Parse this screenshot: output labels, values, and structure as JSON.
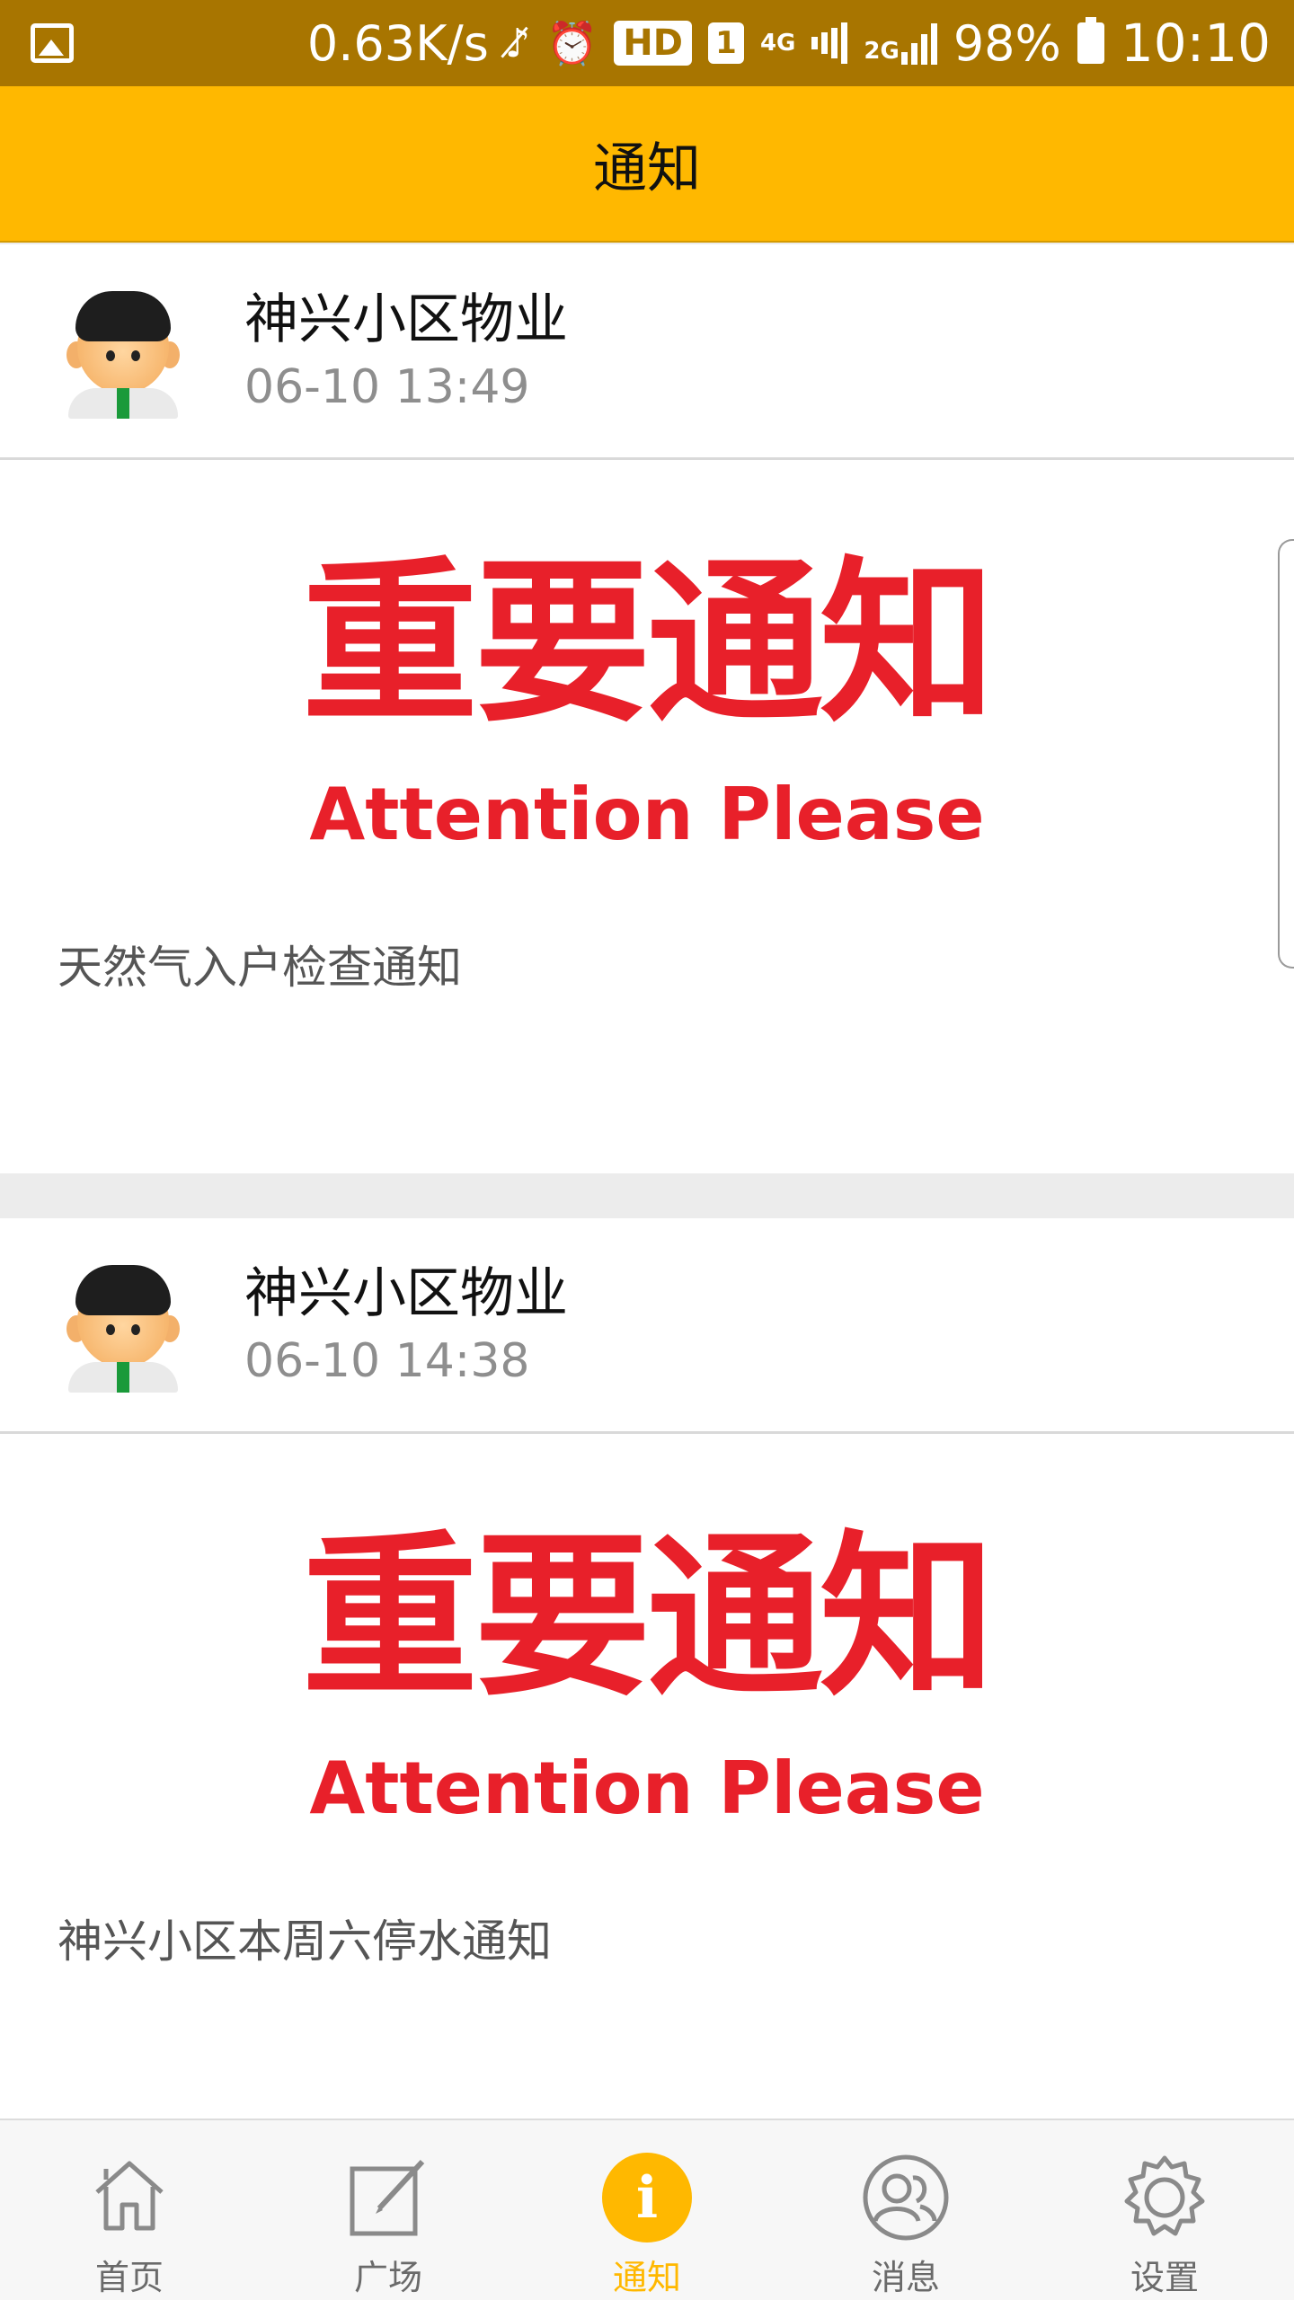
{
  "status_bar": {
    "speed": "0.63K/s",
    "hd": "HD",
    "sim": "1",
    "net_4g": "4G",
    "net_2g": "2G",
    "battery": "98%",
    "time": "10:10"
  },
  "header": {
    "title": "通知"
  },
  "notifications": [
    {
      "sender": "神兴小区物业",
      "time": "06-10 13:49",
      "banner_cn": "重要通知",
      "banner_en": "Attention Please",
      "description": "天然气入户检查通知"
    },
    {
      "sender": "神兴小区物业",
      "time": "06-10 14:38",
      "banner_cn": "重要通知",
      "banner_en": "Attention Please",
      "description": "神兴小区本周六停水通知"
    }
  ],
  "bottom_nav": {
    "items": [
      {
        "label": "首页",
        "icon": "home-icon"
      },
      {
        "label": "广场",
        "icon": "edit-icon"
      },
      {
        "label": "通知",
        "icon": "info-icon",
        "active": true
      },
      {
        "label": "消息",
        "icon": "users-icon"
      },
      {
        "label": "设置",
        "icon": "gear-icon"
      }
    ]
  },
  "colors": {
    "status_bar": "#a87500",
    "accent": "#ffb800",
    "banner_red": "#e8202a"
  }
}
